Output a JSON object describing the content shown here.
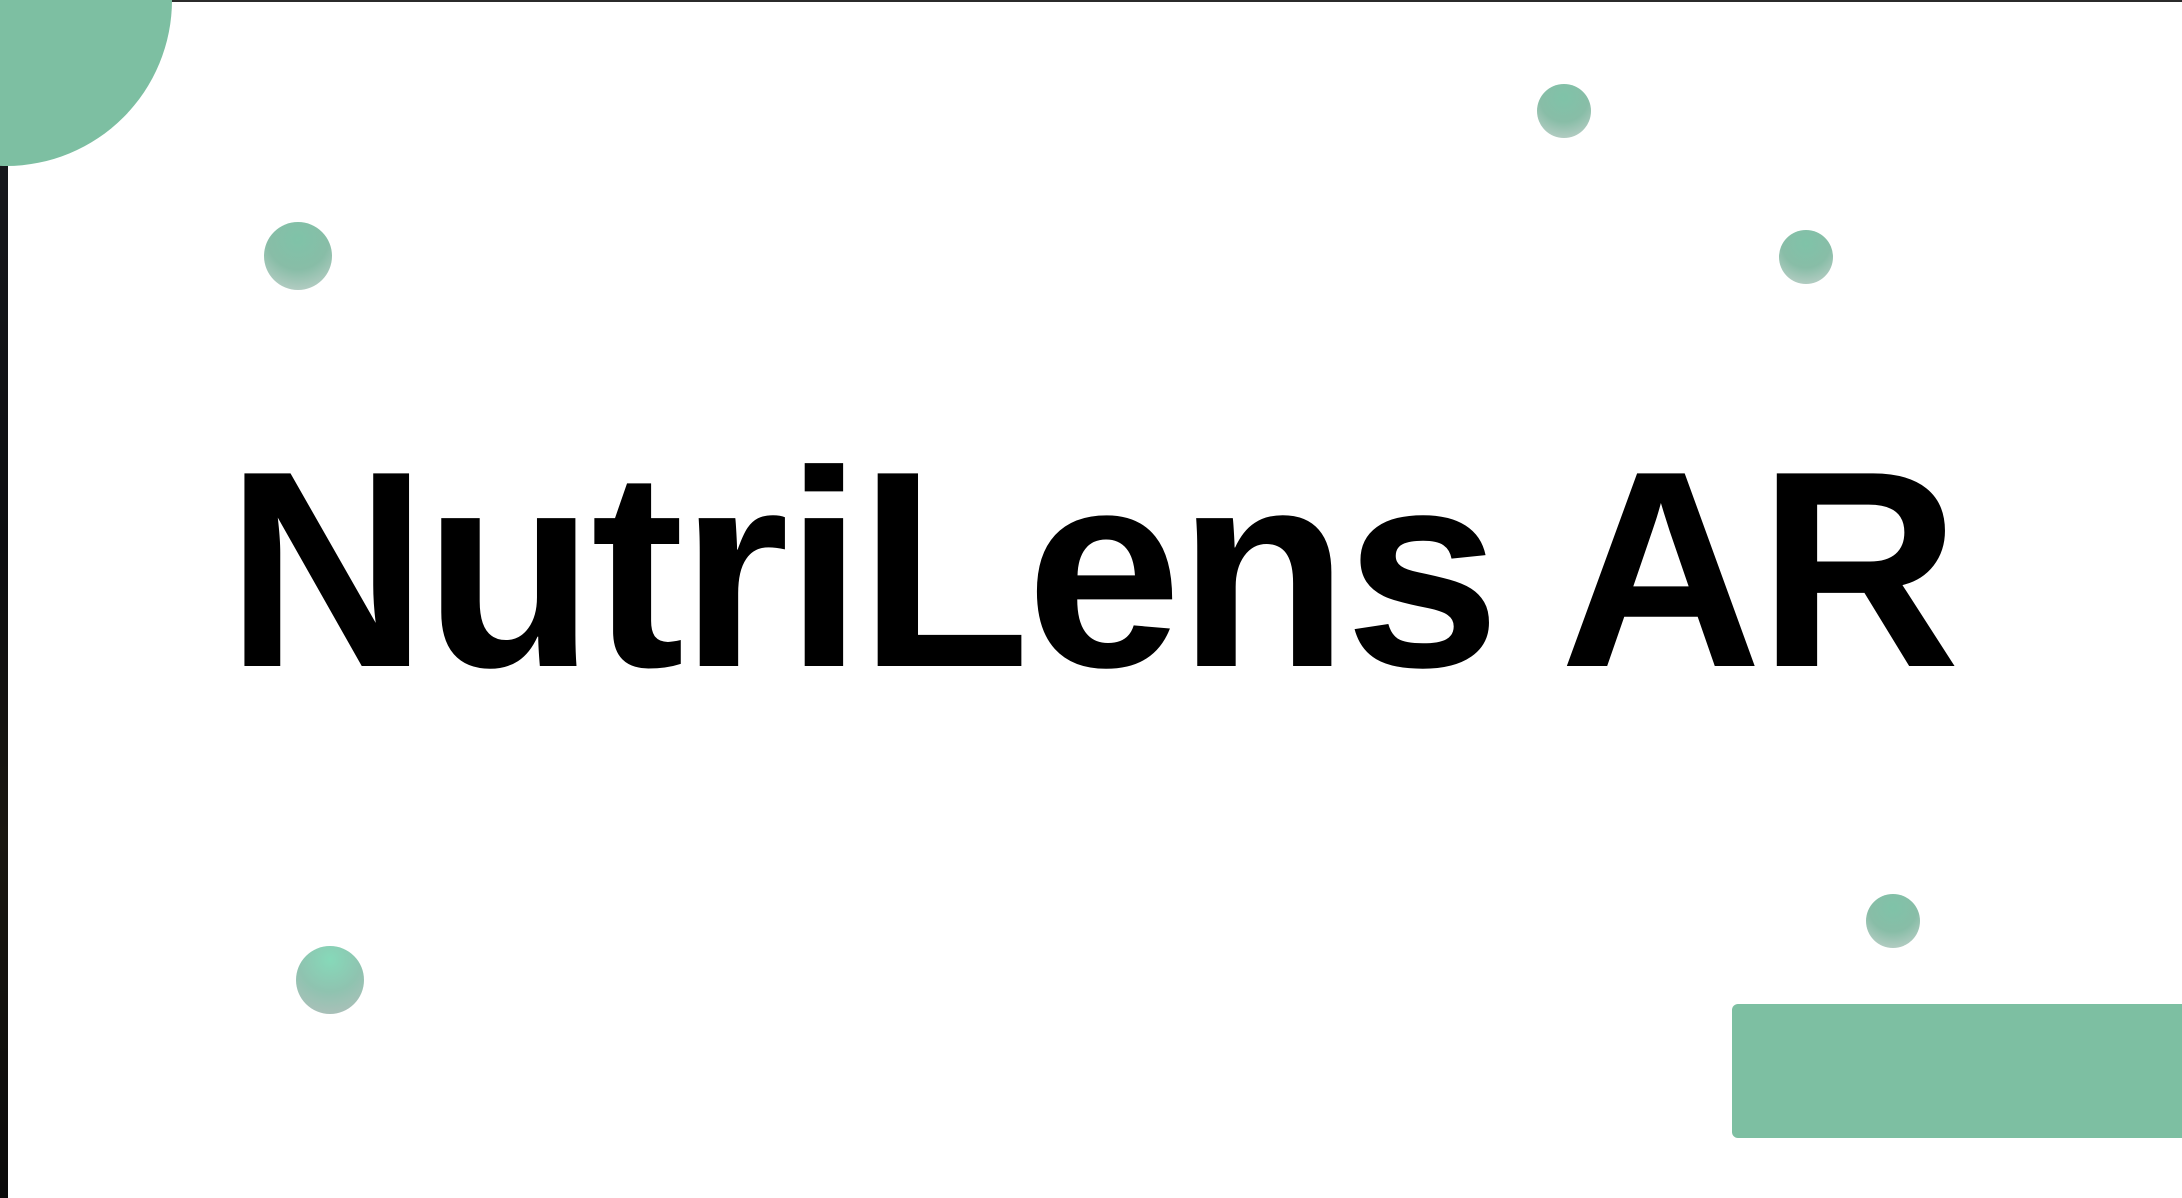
{
  "slide": {
    "title": "NutriLens AR"
  },
  "colors": {
    "accent": "#7dbfa2",
    "background": "#ffffff",
    "title_text": "#000000"
  }
}
